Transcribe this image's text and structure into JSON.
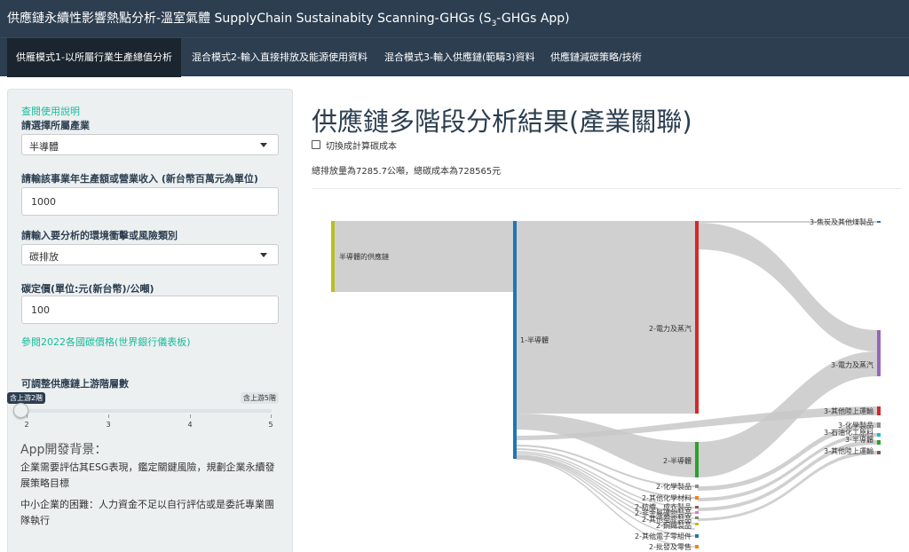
{
  "app": {
    "title": "供應鏈永續性影響熱點分析-溫室氣體 SupplyChain Sustainabity Scanning-GHGs (S",
    "title_sub": "3",
    "title_tail": "-GHGs App)"
  },
  "tabs": [
    {
      "label": "供雁模式1-以所屬行業生產總值分析",
      "active": true
    },
    {
      "label": "混合模式2-輸入直接排放及能源使用資料",
      "active": false
    },
    {
      "label": "混合模式3-輸入供應鏈(範疇3)資料",
      "active": false
    },
    {
      "label": "供應鏈減碳策略/技術",
      "active": false
    }
  ],
  "sidebar": {
    "help_link": "查閱使用說明",
    "industry_label": "請選擇所屬產業",
    "industry_value": "半導體",
    "revenue_label": "請輸該事業年生產額或營業收入 (新台幣百萬元為單位)",
    "revenue_value": "1000",
    "impact_label": "請輸入要分析的環境衝擊或風險類別",
    "impact_value": "碳排放",
    "carbon_price_label": "碳定價(單位:元(新台幣)/公噸)",
    "carbon_price_value": "100",
    "price_link": "參閱2022各國碳價格(世界銀行儀表板)",
    "slider_label": "可調整供應鏈上游階層數",
    "slider_min_badge": "含上游2階",
    "slider_max_badge": "含上游5階",
    "slider_ticks": [
      "2",
      "3",
      "4",
      "5"
    ],
    "slider_value": 2,
    "bg_heading": "App開發背景：",
    "bg_para1": "企業需要評估其ESG表現，鑑定關鍵風險，規劃企業永續發展策略目標",
    "bg_para2": "中小企業的困難：人力資金不足以自行評估或是委託專業團隊執行"
  },
  "main": {
    "title": "供應鏈多階段分析結果(產業關聯)",
    "checkbox_label": "切換成計算碳成本",
    "summary": "總排放量為7285.7公噸，總碳成本為728565元"
  },
  "sankey": {
    "nodes": [
      {
        "label": "半導體的供應鏈",
        "color": "#bcbd22"
      },
      {
        "label": "1-半導體",
        "color": "#1f77b4"
      },
      {
        "label": "2-電力及蒸汽",
        "color": "#d62728"
      },
      {
        "label": "2-半導體",
        "color": "#2ca02c"
      },
      {
        "label": "2-化學製品",
        "color": "#8c8c8c"
      },
      {
        "label": "2-其他化學材料",
        "color": "#ff7f0e"
      },
      {
        "label": "2-紡織、成衣製品",
        "color": "#8c564b"
      },
      {
        "label": "2-非金屬礦物製品",
        "color": "#e377c2"
      },
      {
        "label": "2-其他塑膠製品",
        "color": "#7f7f7f"
      },
      {
        "label": "2-鋼鐵製品",
        "color": "#bcbd22"
      },
      {
        "label": "2-其他電子零組件",
        "color": "#1f77b4"
      },
      {
        "label": "2-批發及零售",
        "color": "#ff7f0e"
      },
      {
        "label": "3-焦炭及其他煤製品",
        "color": "#1f77b4"
      },
      {
        "label": "3-電力及蒸汽",
        "color": "#9467bd"
      },
      {
        "label": "3-其他陸上運輸",
        "color": "#d62728"
      },
      {
        "label": "3-化學製品",
        "color": "#8c8c8c"
      },
      {
        "label": "3-石油化工原料",
        "color": "#17becf"
      },
      {
        "label": "3-半導體",
        "color": "#2ca02c"
      },
      {
        "label": "3-其他陸上運輸",
        "color": "#8c564b"
      }
    ]
  }
}
